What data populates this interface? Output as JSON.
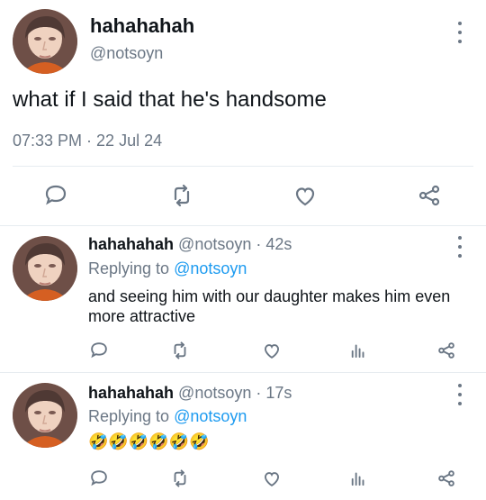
{
  "main_tweet": {
    "display_name": "hahahahah",
    "handle": "@notsoyn",
    "text": "what if I said that he's handsome",
    "timestamp": "07:33 PM · 22 Jul 24",
    "actions": {
      "reply_icon": "reply-icon",
      "retweet_icon": "retweet-icon",
      "like_icon": "like-icon",
      "share_icon": "share-icon"
    }
  },
  "replies": [
    {
      "display_name": "hahahahah",
      "handle_time": "@notsoyn · 42s",
      "replying_prefix": "Replying to",
      "replying_to": "@notsoyn",
      "text": "and seeing him with our daughter makes him even more attractive"
    },
    {
      "display_name": "hahahahah",
      "handle_time": "@notsoyn · 17s",
      "replying_prefix": "Replying to",
      "replying_to": "@notsoyn",
      "text": "🤣🤣🤣🤣🤣🤣"
    }
  ],
  "colors": {
    "text": "#0f1419",
    "muted": "#6b7785",
    "link": "#1d9bf0",
    "divider": "#e6ecf0"
  }
}
